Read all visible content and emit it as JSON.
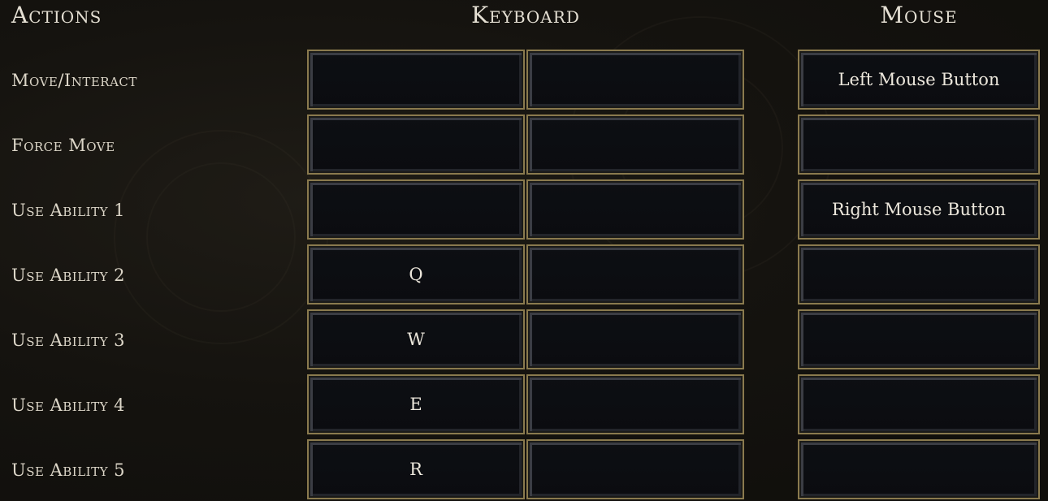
{
  "headers": {
    "actions": "Actions",
    "keyboard": "Keyboard",
    "mouse": "Mouse"
  },
  "rows": [
    {
      "action": "Move/Interact",
      "key1": "",
      "key2": "",
      "mouse": "Left Mouse Button"
    },
    {
      "action": "Force Move",
      "key1": "",
      "key2": "",
      "mouse": ""
    },
    {
      "action": "Use Ability 1",
      "key1": "",
      "key2": "",
      "mouse": "Right Mouse Button"
    },
    {
      "action": "Use Ability 2",
      "key1": "Q",
      "key2": "",
      "mouse": ""
    },
    {
      "action": "Use Ability 3",
      "key1": "W",
      "key2": "",
      "mouse": ""
    },
    {
      "action": "Use Ability 4",
      "key1": "E",
      "key2": "",
      "mouse": ""
    },
    {
      "action": "Use Ability 5",
      "key1": "R",
      "key2": "",
      "mouse": ""
    }
  ],
  "colors": {
    "slot_border": "#8a7a4e",
    "slot_fill": "#0d0f13",
    "text": "#dcd6c8"
  }
}
